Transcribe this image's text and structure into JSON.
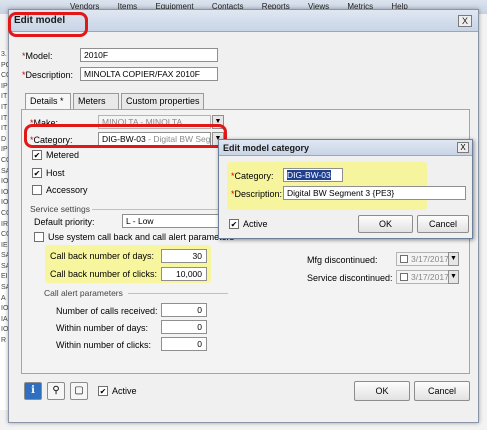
{
  "background": {
    "menu_items": [
      "Vendors",
      "Items",
      "Equipment",
      "Contacts",
      "Reports",
      "Views",
      "Metrics",
      "Help"
    ],
    "left_codes": [
      "3.",
      "PC",
      "",
      "",
      "",
      "CO",
      "IP",
      "IT",
      "IT",
      "IT",
      "IT",
      "D",
      "IP",
      "CO",
      "SA",
      "IO",
      "IO",
      "IO",
      "CO",
      "IR",
      "CO",
      "IE",
      "SA",
      "SA",
      "EI",
      "SA",
      "A",
      "IO",
      "IA",
      "IO",
      "R"
    ]
  },
  "dialog": {
    "title": "Edit model",
    "close_glyph": "X",
    "model_label": "Model:",
    "model_value": "2010F",
    "description_label": "Description:",
    "description_value": "MINOLTA COPIER/FAX 2010F",
    "required_mark": "*",
    "tabs": [
      {
        "label": "Details *"
      },
      {
        "label": "Meters"
      },
      {
        "label": "Custom properties"
      }
    ],
    "make_label": "Make:",
    "make_value": "MINOLTA - MINOLTA",
    "category_label": "Category:",
    "category_code": "DIG-BW-03",
    "category_desc": " - Digital BW Segment",
    "metered_label": "Metered",
    "host_label": "Host",
    "accessory_label": "Accessory",
    "service_settings_label": "Service settings",
    "default_priority_label": "Default priority:",
    "default_priority_value": "L - Low",
    "use_system_label": "Use system call back and call alert parameters",
    "call_back_days_label": "Call back number of days:",
    "call_back_days_value": "30",
    "call_back_clicks_label": "Call back number of clicks:",
    "call_back_clicks_value": "10,000",
    "call_alert_label": "Call alert parameters",
    "calls_received_label": "Number of calls received:",
    "calls_received_value": "0",
    "within_days_label": "Within number of days:",
    "within_days_value": "0",
    "within_clicks_label": "Within number of clicks:",
    "within_clicks_value": "0",
    "mfg_discontinued_label": "Mfg discontinued:",
    "mfg_discontinued_value": "3/17/2017",
    "service_discontinued_label": "Service discontinued:",
    "service_discontinued_value": "3/17/2017",
    "active_label": "Active",
    "ok_label": "OK",
    "cancel_label": "Cancel"
  },
  "subdialog": {
    "title": "Edit model category",
    "close_glyph": "X",
    "category_label": "Category:",
    "category_value": "DIG-BW-03",
    "description_label": "Description:",
    "description_value": "Digital BW Segment 3 {PE3}",
    "active_label": "Active",
    "ok_label": "OK",
    "cancel_label": "Cancel"
  },
  "colors": {
    "highlight_yellow": "#f8f48f",
    "annotation_red": "#e01818",
    "required_red": "#d40000",
    "selection_blue": "#1f3f8f"
  }
}
